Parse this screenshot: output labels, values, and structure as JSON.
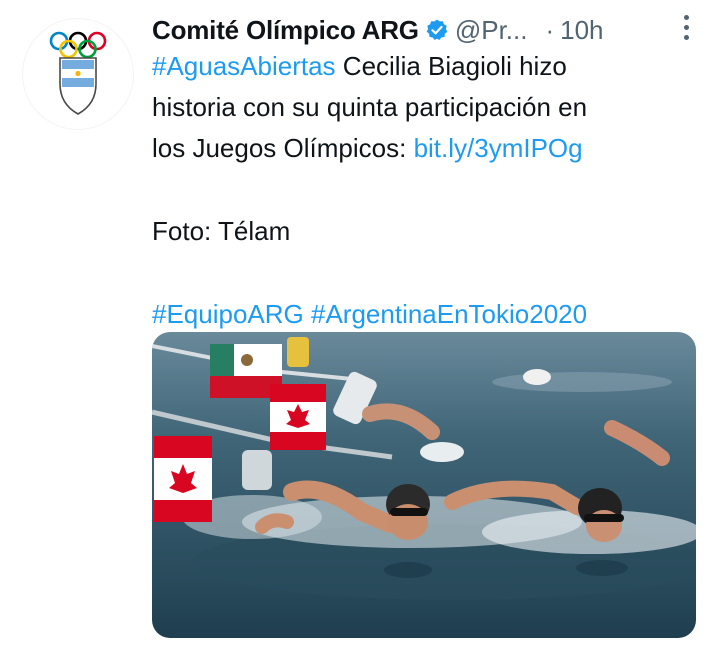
{
  "tweet": {
    "author_name": "Comité Olímpico ARG",
    "handle": "@Pr...",
    "separator": "·",
    "time": "10h",
    "text": {
      "hashtag1": "#AguasAbiertas",
      "line1_rest": " Cecilia Biagioli hizo",
      "line2": "historia con su quinta participación en",
      "line3_start": "los Juegos Olímpicos: ",
      "link": "bit.ly/3ymIPOg",
      "photo_credit": "Foto: Télam",
      "hashtag2": "#EquipoARG",
      "hashtag3": "#ArgentinaEnTokio2020"
    },
    "avatar": {
      "seal_text": "COMITE OLIMPICO ARGENTINO"
    }
  },
  "colors": {
    "link": "#1d9bf0",
    "text": "#0f1419",
    "muted": "#536471",
    "verified": "#1d9bf0",
    "water": "#2c5266"
  },
  "icons": [
    "verified-badge-icon",
    "more-options-icon",
    "olympic-rings-icon"
  ]
}
